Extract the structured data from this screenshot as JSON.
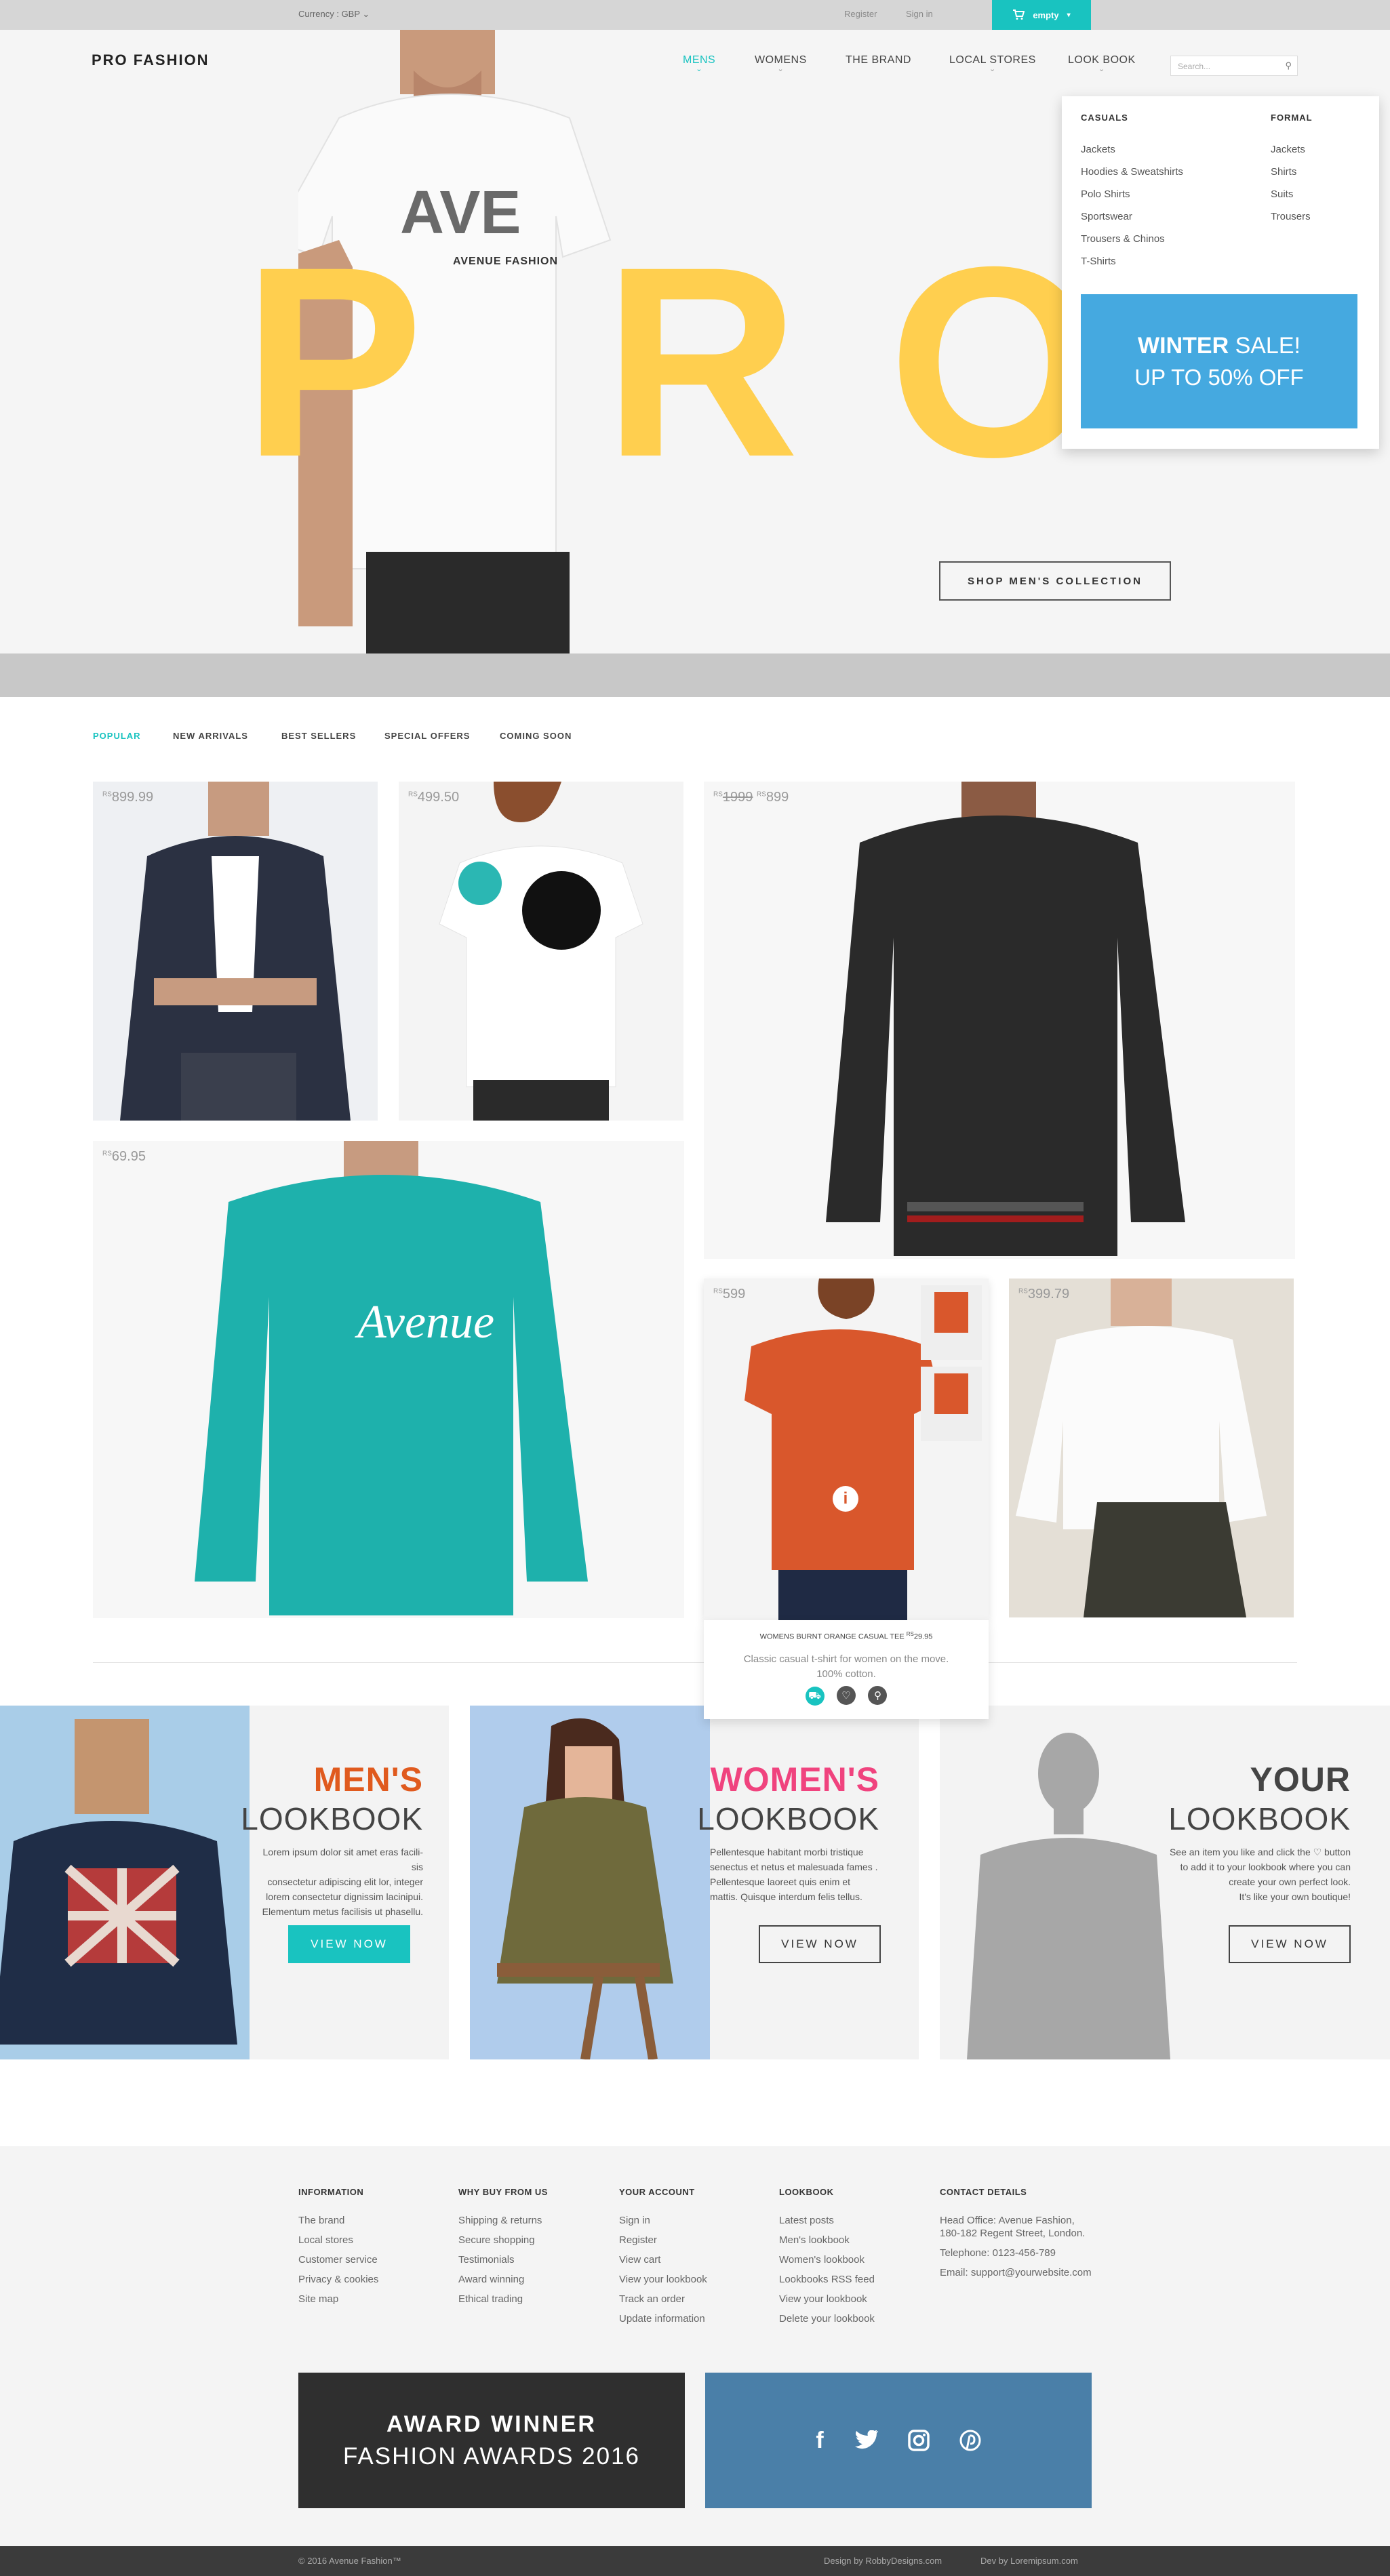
{
  "topbar": {
    "currency": "Currency : GBP ⌄",
    "register": "Register",
    "sign_in": "Sign in",
    "cart_label": "empty",
    "accent": "#19c3c0"
  },
  "header": {
    "logo": "PRO FASHION",
    "search_placeholder": "Search...",
    "nav": [
      "MENS",
      "WOMENS",
      "THE BRAND",
      "LOCAL STORES",
      "LOOK BOOK"
    ]
  },
  "hero": {
    "letters": [
      "P",
      "R",
      "O"
    ],
    "shirt_text": "AVENUE FASHION",
    "shop_button": "SHOP MEN'S COLLECTION"
  },
  "dropdown": {
    "casuals_heading": "CASUALS",
    "casuals": [
      "Jackets",
      "Hoodies & Sweatshirts",
      "Polo Shirts",
      "Sportswear",
      "Trousers & Chinos",
      "T-Shirts"
    ],
    "formal_heading": "FORMAL",
    "formal": [
      "Jackets",
      "Shirts",
      "Suits",
      "Trousers"
    ],
    "sale_word": "WINTER",
    "sale_rest": " SALE!",
    "sale_line2": "UP TO 50% OFF"
  },
  "tabs": [
    "POPULAR",
    "NEW ARRIVALS",
    "BEST SELLERS",
    "SPECIAL OFFERS",
    "COMING SOON"
  ],
  "products": {
    "currency": "RS",
    "blazer": "899.99",
    "tee_woman": "499.50",
    "sweater_old": "1999",
    "sweater_new": "899",
    "henley": "69.95",
    "orange_tee": "599",
    "white_shirt": "399.79"
  },
  "hover": {
    "name": "WOMENS BURNT ORANGE CASUAL TEE",
    "price": "29.95",
    "desc1": "Classic casual t-shirt for women on the move.",
    "desc2": "100% cotton."
  },
  "lookbooks": {
    "mens_title": "MEN'S",
    "womens_title": "WOMEN'S",
    "yours_title": "YOUR",
    "subtitle": "LOOKBOOK",
    "mens_text": [
      "Lorem ipsum dolor sit amet eras facili-",
      "sis",
      "consectetur adipiscing elit lor, integer",
      "lorem consectetur dignissim lacinipui.",
      "Elementum metus facilisis ut phasellu."
    ],
    "womens_text": [
      "Pellentesque habitant morbi tristique",
      "senectus et netus et malesuada fames .",
      "Pellentesque laoreet quis enim et",
      "mattis. Quisque interdum felis tellus."
    ],
    "yours_text": [
      "See an item you like and click the ♡ button",
      "to add it to your lookbook where you can",
      "create your own perfect look.",
      "It's like your own boutique!"
    ],
    "button": "VIEW NOW",
    "mens_color": "#e05a1e",
    "womens_color": "#f0437e"
  },
  "footer": {
    "cols": [
      {
        "heading": "INFORMATION",
        "items": [
          "The brand",
          "Local stores",
          "Customer service",
          "Privacy & cookies",
          "Site map"
        ]
      },
      {
        "heading": "WHY BUY FROM US",
        "items": [
          "Shipping & returns",
          "Secure shopping",
          "Testimonials",
          "Award winning",
          "Ethical trading"
        ]
      },
      {
        "heading": "YOUR ACCOUNT",
        "items": [
          "Sign in",
          "Register",
          "View cart",
          "View your lookbook",
          "Track an order",
          "Update information"
        ]
      },
      {
        "heading": "LOOKBOOK",
        "items": [
          "Latest posts",
          "Men's lookbook",
          "Women's lookbook",
          "Lookbooks RSS feed",
          "View your lookbook",
          "Delete your lookbook"
        ]
      },
      {
        "heading": "CONTACT DETAILS",
        "items": [
          "Head Office: Avenue Fashion,",
          "180-182 Regent Street, London.",
          "",
          "Telephone: 0123-456-789",
          "Email: support@yourwebsite.com"
        ]
      }
    ],
    "award_line1": "AWARD WINNER",
    "award_line2": "FASHION AWARDS 2016",
    "copyright": "© 2016 Avenue Fashion™",
    "design_by": "Design by RobbyDesigns.com",
    "dev_by": "Dev by Loremipsum.com"
  }
}
